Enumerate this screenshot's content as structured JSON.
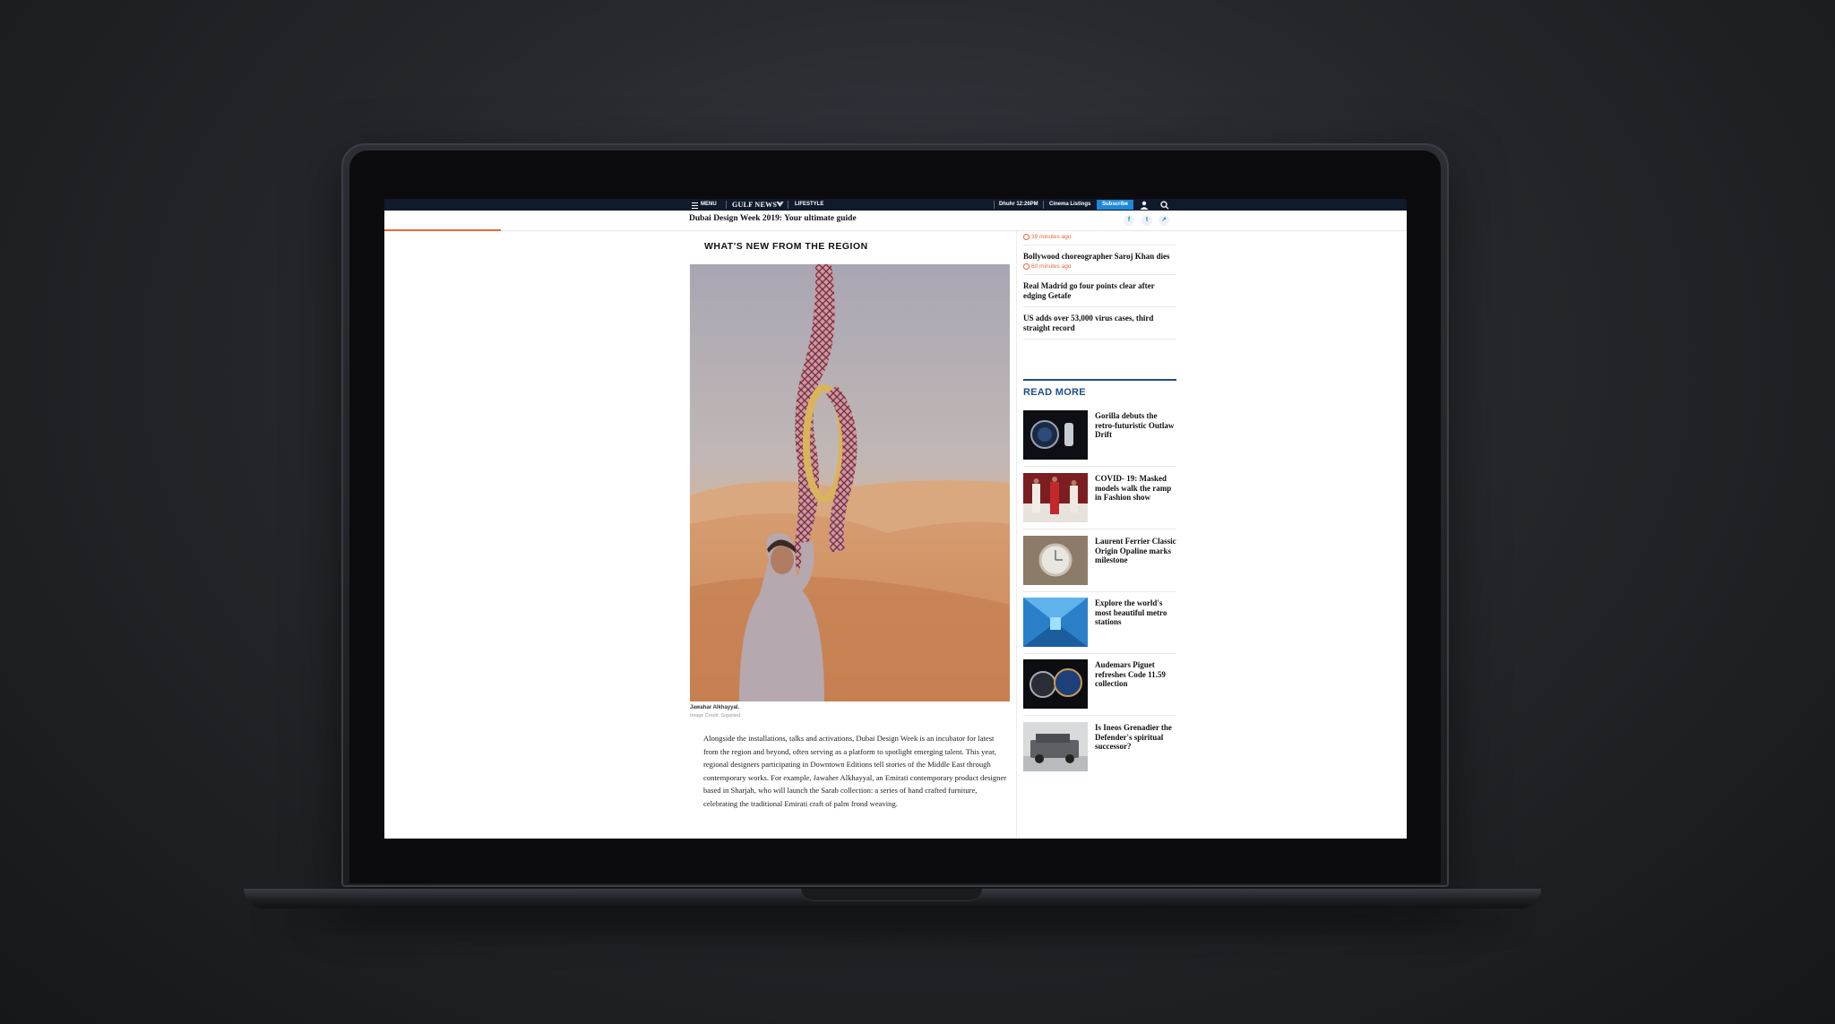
{
  "topbar": {
    "menu_label": "MENU",
    "logo": "GULF NEWS",
    "section": "LIFESTYLE",
    "prayer": "Dhuhr  12:26PM",
    "cinema": "Cinema Listings",
    "subscribe": "Subscribe"
  },
  "article": {
    "title": "Dubai Design Week 2019: Your ultimate guide",
    "section_heading": "WHAT'S NEW FROM THE REGION",
    "caption_name": "Jawahar Alkhayyal.",
    "caption_credit": "Image Credit: Supplied",
    "body": "Alongside the installations, talks and activations, Dubai Design Week is an incubator for latest from the region and beyond, often serving as a platform to spotlight emerging talent. This year, regional designers participating in Downtown Editions tell stories of the Middle East through contemporary works. For example, Jawaher Alkhayyal, an Emirati contemporary product designer based in Sharjah, who will launch the Sarab collection: a series of hand crafted furniture, celebrating the traditional Emirati craft of palm frond weaving."
  },
  "sidebar": {
    "top_timestamp": "39 minutes ago",
    "latest": [
      {
        "title": "Bollywood choreographer Saroj Khan dies",
        "time": "60 minutes ago"
      },
      {
        "title": "Real Madrid go four points clear after edging Getafe",
        "time": ""
      },
      {
        "title": "US adds over 53,000 virus cases, third straight record",
        "time": ""
      }
    ],
    "read_more_label": "READ MORE",
    "read_more": [
      {
        "title": "Gorilla debuts the retro-futuristic Outlaw Drift",
        "thumb": "watch-dark"
      },
      {
        "title": "COVID- 19: Masked models walk the ramp in Fashion show",
        "thumb": "fashion-show"
      },
      {
        "title": "Laurent Ferrier Classic Origin Opaline marks milestone",
        "thumb": "watch-light"
      },
      {
        "title": "Explore the world's most beautiful metro stations",
        "thumb": "metro-station"
      },
      {
        "title": "Audemars Piguet refreshes Code 11.59 collection",
        "thumb": "watch-blue"
      },
      {
        "title": "Is Ineos Grenadier the Defender's spiritual successor?",
        "thumb": "suv"
      }
    ]
  },
  "colors": {
    "topbar_bg": "#0f1a2b",
    "subscribe_bg": "#1e88d6",
    "accent_orange": "#e8663a",
    "read_more_blue": "#1f4e8c"
  }
}
